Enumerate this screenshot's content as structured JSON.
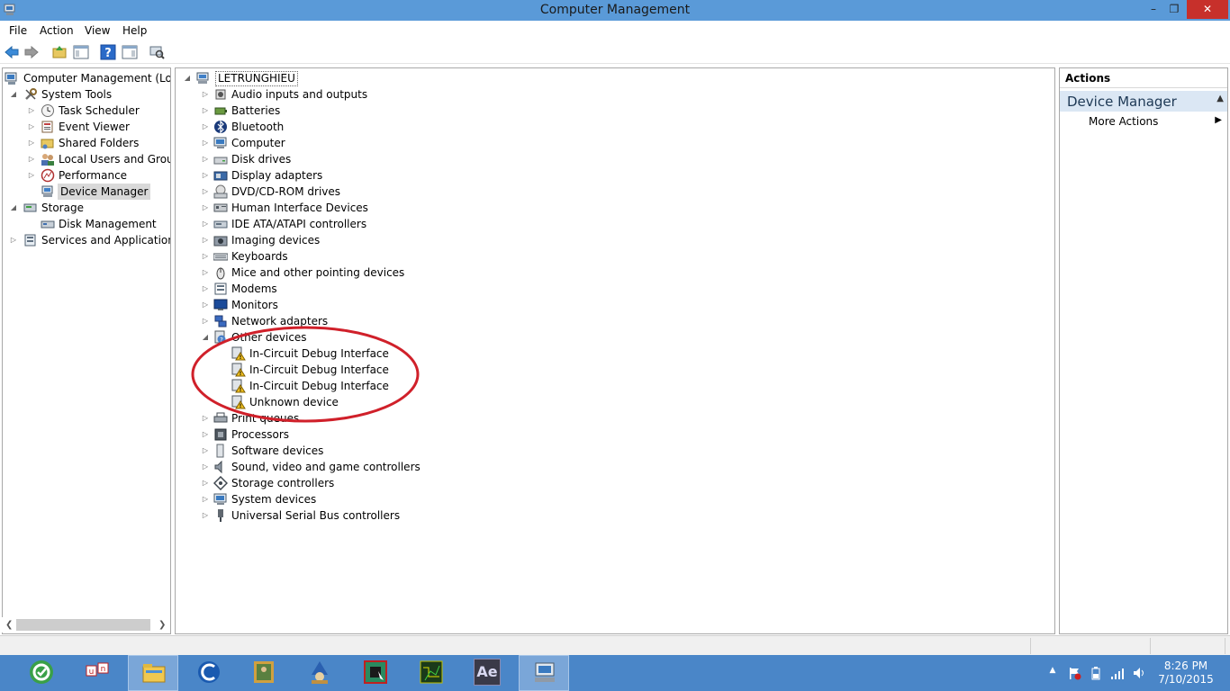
{
  "window": {
    "title": "Computer Management",
    "minimize": "–",
    "maximize": "❐",
    "close": "✕"
  },
  "menu": [
    "File",
    "Action",
    "View",
    "Help"
  ],
  "left_tree": [
    {
      "label": "Computer Management (Local",
      "icon": "computer-management-icon"
    },
    {
      "label": "System Tools",
      "icon": "tools-icon"
    },
    {
      "label": "Task Scheduler",
      "icon": "clock-icon"
    },
    {
      "label": "Event Viewer",
      "icon": "event-viewer-icon"
    },
    {
      "label": "Shared Folders",
      "icon": "shared-folder-icon"
    },
    {
      "label": "Local Users and Groups",
      "icon": "users-icon"
    },
    {
      "label": "Performance",
      "icon": "performance-icon"
    },
    {
      "label": "Device Manager",
      "icon": "device-manager-icon"
    },
    {
      "label": "Storage",
      "icon": "storage-icon"
    },
    {
      "label": "Disk Management",
      "icon": "disk-management-icon"
    },
    {
      "label": "Services and Applications",
      "icon": "services-icon"
    }
  ],
  "device_tree": {
    "root": "LETRUNGHIEU",
    "categories": [
      "Audio inputs and outputs",
      "Batteries",
      "Bluetooth",
      "Computer",
      "Disk drives",
      "Display adapters",
      "DVD/CD-ROM drives",
      "Human Interface Devices",
      "IDE ATA/ATAPI controllers",
      "Imaging devices",
      "Keyboards",
      "Mice and other pointing devices",
      "Modems",
      "Monitors",
      "Network adapters",
      "Other devices"
    ],
    "other_devices": [
      "In-Circuit Debug Interface",
      "In-Circuit Debug Interface",
      "In-Circuit Debug Interface",
      "Unknown device"
    ],
    "categories_after": [
      "Print queues",
      "Processors",
      "Software devices",
      "Sound, video and game controllers",
      "Storage controllers",
      "System devices",
      "Universal Serial Bus controllers"
    ]
  },
  "actions": {
    "header": "Actions",
    "section": "Device Manager",
    "item": "More Actions"
  },
  "taskbar": {
    "apps": [
      "coccoc-browser-icon",
      "unikey-icon",
      "file-explorer-icon",
      "ccleaner-icon",
      "photo-app-icon",
      "wizard-app-icon",
      "chip-programmer-icon",
      "circuit-design-icon",
      "after-effects-icon",
      "computer-management-task-icon"
    ],
    "ae_label": "Ae",
    "time": "8:26 PM",
    "date": "7/10/2015"
  },
  "colors": {
    "titlebar": "#5a9ad8",
    "taskbar": "#4a86c8",
    "close_button": "#c7302b",
    "annotation": "#d0202a",
    "actions_section": "#dbe7f4"
  }
}
